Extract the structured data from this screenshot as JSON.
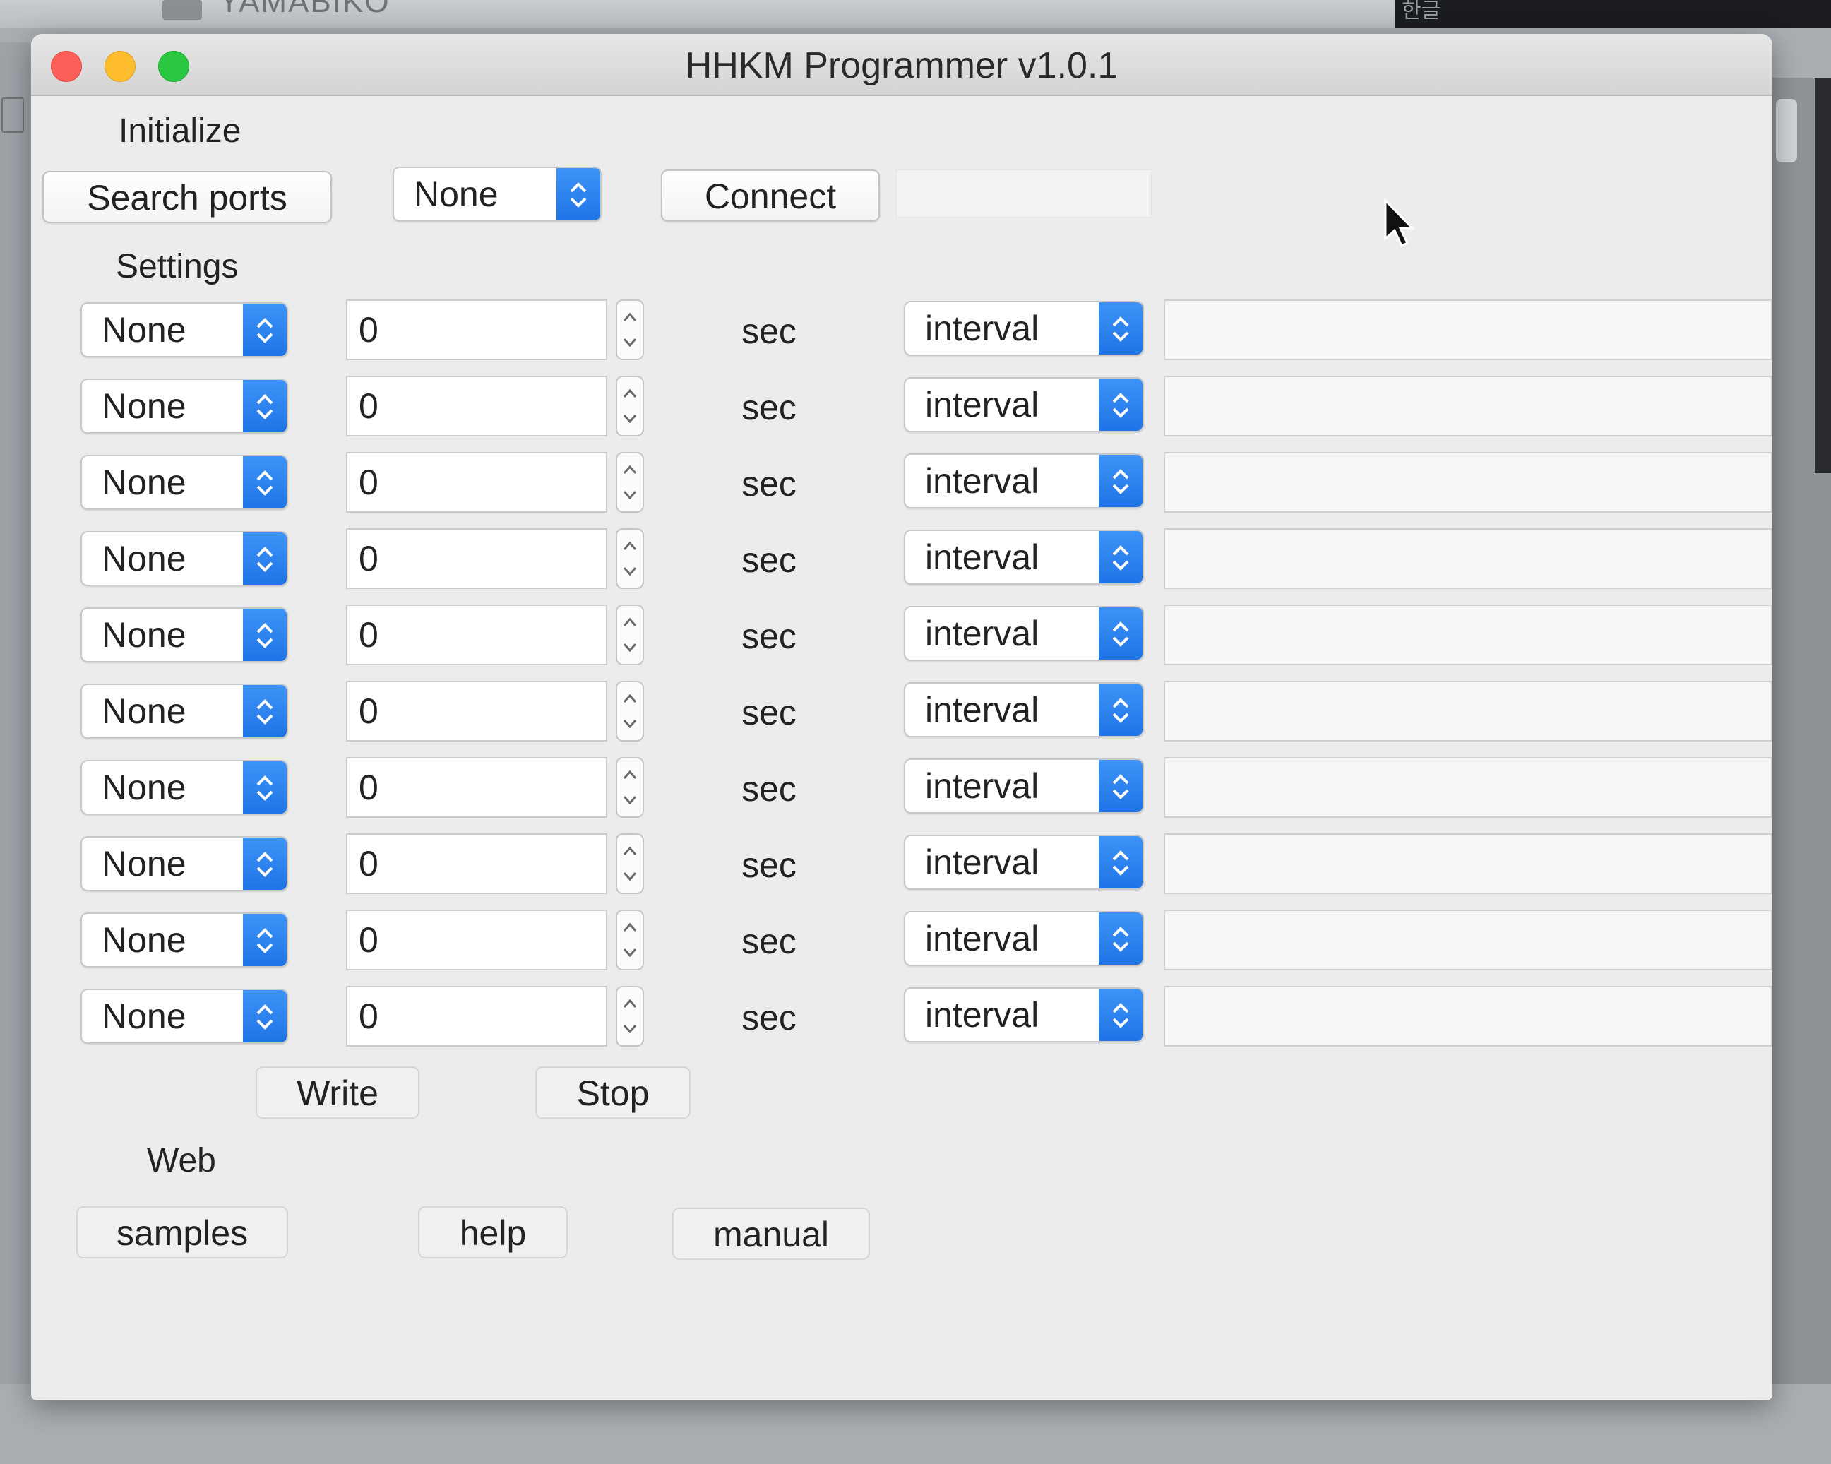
{
  "background": {
    "top_left_label": "YAMABIKO",
    "top_right_label": "한글"
  },
  "window": {
    "title": "HHKM Programmer v1.0.1"
  },
  "initialize": {
    "section_label": "Initialize",
    "search_ports_label": "Search ports",
    "port_select_value": "None",
    "connect_label": "Connect"
  },
  "settings": {
    "section_label": "Settings",
    "unit_label": "sec",
    "rows": [
      {
        "key": "None",
        "value": "0",
        "mode": "interval"
      },
      {
        "key": "None",
        "value": "0",
        "mode": "interval"
      },
      {
        "key": "None",
        "value": "0",
        "mode": "interval"
      },
      {
        "key": "None",
        "value": "0",
        "mode": "interval"
      },
      {
        "key": "None",
        "value": "0",
        "mode": "interval"
      },
      {
        "key": "None",
        "value": "0",
        "mode": "interval"
      },
      {
        "key": "None",
        "value": "0",
        "mode": "interval"
      },
      {
        "key": "None",
        "value": "0",
        "mode": "interval"
      },
      {
        "key": "None",
        "value": "0",
        "mode": "interval"
      },
      {
        "key": "None",
        "value": "0",
        "mode": "interval"
      }
    ],
    "write_label": "Write",
    "stop_label": "Stop"
  },
  "web": {
    "section_label": "Web",
    "samples_label": "samples",
    "help_label": "help",
    "manual_label": "manual"
  },
  "colors": {
    "select_accent": "#2a7ff0",
    "close": "#fc5f57",
    "minimize": "#fdbd2e",
    "maximize": "#2ac840"
  }
}
